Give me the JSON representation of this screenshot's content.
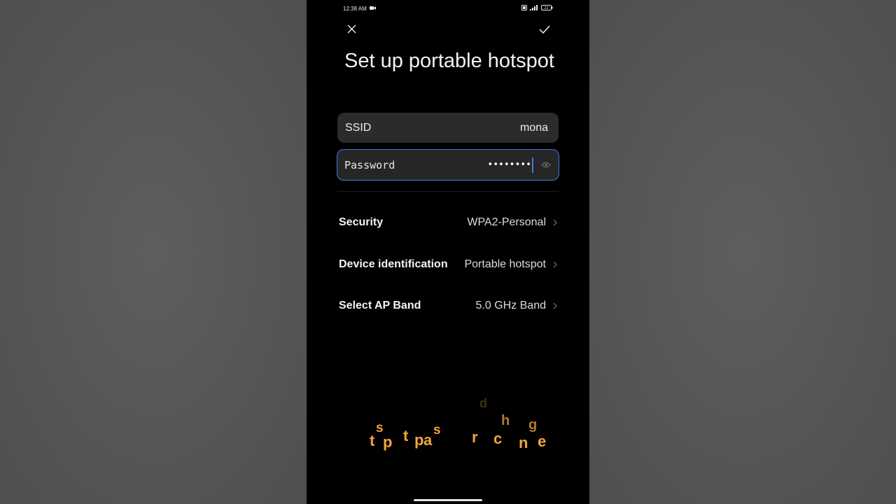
{
  "status_bar": {
    "time": "12:38 AM",
    "battery": "22"
  },
  "header": {
    "title": "Set up portable hotspot"
  },
  "ssid": {
    "label": "SSID",
    "value": "mona"
  },
  "password": {
    "label": "Password",
    "value": "••••••••"
  },
  "settings": [
    {
      "label": "Security",
      "value": "WPA2-Personal"
    },
    {
      "label": "Device identification",
      "value": "Portable hotspot"
    },
    {
      "label": "Select AP Band",
      "value": "5.0 GHz Band"
    }
  ],
  "overlay_letters": [
    "t",
    "s",
    "p",
    "t",
    "p",
    "a",
    "s",
    "r",
    "c",
    "h",
    "d",
    "n",
    "g",
    "e"
  ],
  "colors": {
    "accent": "#3e7bd6",
    "overlay_text": "#f2a53a",
    "background": "#000000",
    "field_background": "#2b2b2b"
  },
  "icons": [
    "close-icon",
    "check-icon",
    "eye-icon",
    "chevron-right-icon",
    "video-icon",
    "signal-icon",
    "battery-icon"
  ]
}
